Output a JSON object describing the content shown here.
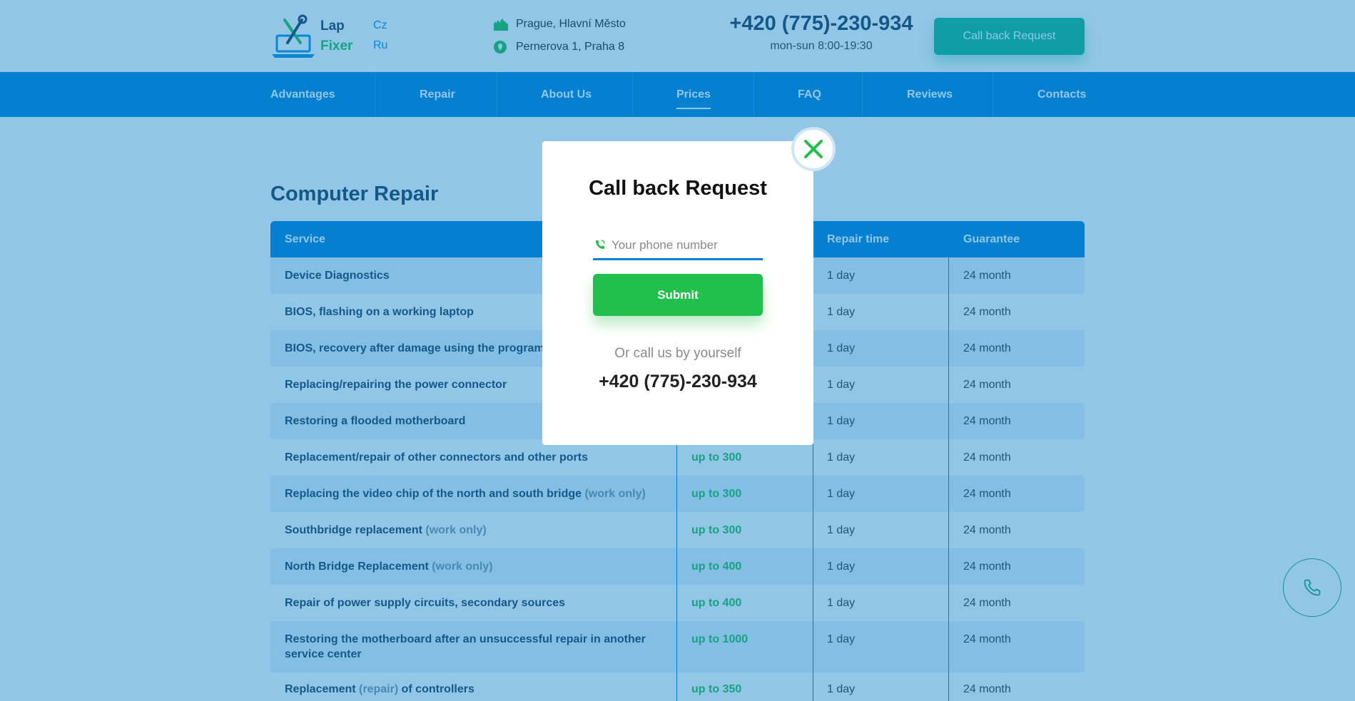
{
  "header": {
    "logo_word1": "Lap",
    "logo_word2": "Fixer",
    "langs": [
      "Cz",
      "Ru"
    ],
    "location": "Prague, Hlavní Město",
    "address": "Pernerova 1, Praha 8",
    "phone": "+420 (775)-230-934",
    "hours": "mon-sun  8:00-19:30",
    "callback_label": "Call back Request"
  },
  "nav": {
    "items": [
      "Advantages",
      "Repair",
      "About Us",
      "Prices",
      "FAQ",
      "Reviews",
      "Contacts"
    ],
    "active": "Prices"
  },
  "section": {
    "title": "Computer Repair",
    "columns": [
      "Service",
      "",
      "Repair time",
      "Guarantee"
    ],
    "rows": [
      {
        "service": "Device Diagnostics",
        "note": "",
        "price": "",
        "time": "1 day",
        "guarantee": "24 month"
      },
      {
        "service": "BIOS, flashing on a working laptop",
        "note": "",
        "price": "",
        "time": "1 day",
        "guarantee": "24 month"
      },
      {
        "service": "BIOS, recovery after damage using the programme",
        "note": "",
        "price": "",
        "time": "1 day",
        "guarantee": "24 month"
      },
      {
        "service": "Replacing/repairing the power connector",
        "note": "",
        "price": "",
        "time": "1 day",
        "guarantee": "24 month"
      },
      {
        "service": "Restoring a flooded motherboard",
        "note": "",
        "price": "",
        "time": "1 day",
        "guarantee": "24 month"
      },
      {
        "service": "Replacement/repair of other connectors and other ports",
        "note": "",
        "price": "up to 300",
        "time": "1 day",
        "guarantee": "24 month"
      },
      {
        "service": "Replacing the video chip of the north and south bridge",
        "note": "(work only)",
        "price": "up to 300",
        "time": "1 day",
        "guarantee": "24 month"
      },
      {
        "service": "Southbridge replacement",
        "note": "(work only)",
        "price": "up to 300",
        "time": "1 day",
        "guarantee": "24 month"
      },
      {
        "service": "North Bridge Replacement",
        "note": "(work only)",
        "price": "up to 400",
        "time": "1 day",
        "guarantee": "24 month"
      },
      {
        "service": "Repair of power supply circuits, secondary sources",
        "note": "",
        "price": "up to 400",
        "time": "1 day",
        "guarantee": "24 month"
      },
      {
        "service": "Restoring the motherboard after an unsuccessful repair in another",
        "service_line2": "service center",
        "note": "",
        "price": "up to 1000",
        "time": "1 day",
        "guarantee": "24 month"
      },
      {
        "service": "Replacement",
        "note": "(repair)",
        "service_tail": "of controllers",
        "price": "up to 350",
        "time": "1 day",
        "guarantee": "24 month"
      }
    ]
  },
  "modal": {
    "title": "Call back Request",
    "phone_placeholder": "Your phone number",
    "submit_label": "Submit",
    "or_call": "Or call us by yourself",
    "phone": "+420 (775)-230-934"
  },
  "colors": {
    "primary_blue": "#0080d8",
    "accent_green": "#21bf4b",
    "teal_button": "#15b68a",
    "heading_navy": "#1d3557"
  },
  "icons": [
    "logo-laptop-tools-icon",
    "city-icon",
    "location-pin-icon",
    "phone-icon",
    "close-icon",
    "floating-phone-icon"
  ]
}
